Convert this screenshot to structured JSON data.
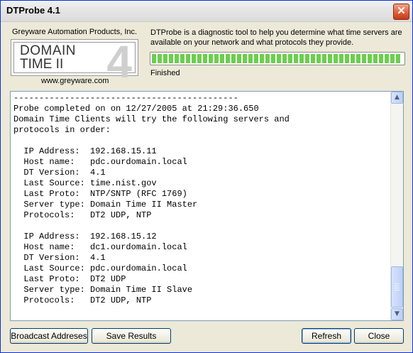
{
  "window": {
    "title": "DTProbe 4.1",
    "close_glyph": "✕"
  },
  "header": {
    "company": "Greyware Automation Products, Inc.",
    "logo_line1": "DOMAIN",
    "logo_line2": "TIME II",
    "logo_mark": "4",
    "url": "www.greyware.com",
    "description": "DTProbe is a diagnostic tool to help you determine what time servers are available on your network and what protocols they provide.",
    "progress_fraction": 1.0,
    "status": "Finished"
  },
  "output": {
    "text": "--------------------------------------------\nProbe completed on on 12/27/2005 at 21:29:36.650\nDomain Time Clients will try the following servers and\nprotocols in order:\n\n  IP Address:  192.168.15.11\n  Host name:   pdc.ourdomain.local\n  DT Version:  4.1\n  Last Source: time.nist.gov\n  Last Proto:  NTP/SNTP (RFC 1769)\n  Server type: Domain Time II Master\n  Protocols:   DT2 UDP, NTP\n\n  IP Address:  192.168.15.12\n  Host name:   dc1.ourdomain.local\n  DT Version:  4.1\n  Last Source: pdc.ourdomain.local\n  Last Proto:  DT2 UDP\n  Server type: Domain Time II Slave\n  Protocols:   DT2 UDP, NTP"
  },
  "scrollbar": {
    "up_icon": "up-arrow-icon",
    "down_icon": "down-arrow-icon",
    "up_glyph": "▲",
    "down_glyph": "▼"
  },
  "buttons": {
    "broadcast": "Broadcast Addreses",
    "save": "Save Results",
    "refresh": "Refresh",
    "close": "Close"
  }
}
